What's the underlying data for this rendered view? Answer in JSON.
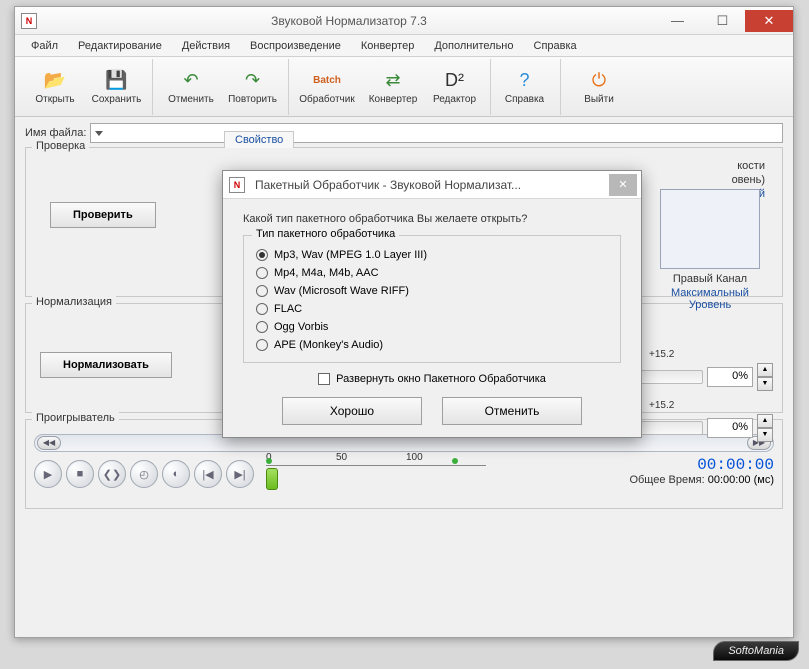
{
  "titlebar": {
    "title": "Звуковой Нормализатор 7.3",
    "icon_text": "N"
  },
  "menu": [
    "Файл",
    "Редактирование",
    "Действия",
    "Воспроизведение",
    "Конвертер",
    "Дополнительно",
    "Справка"
  ],
  "toolbar": [
    {
      "label": "Открыть",
      "icon": "📂",
      "color": "#e8a02c"
    },
    {
      "label": "Сохранить",
      "icon": "💾",
      "color": "#5a7fb8"
    },
    {
      "label": "Отменить",
      "icon": "↶",
      "color": "#3a8a3a"
    },
    {
      "label": "Повторить",
      "icon": "↷",
      "color": "#3a8a3a"
    },
    {
      "label": "Обработчик",
      "icon": "Batch",
      "color": "#d06020",
      "small": true
    },
    {
      "label": "Конвертер",
      "icon": "⇄",
      "color": "#3a8a3a"
    },
    {
      "label": "Редактор",
      "icon": "D²",
      "color": "#333"
    },
    {
      "label": "Справка",
      "icon": "?",
      "color": "#2a8cd8"
    },
    {
      "label": "Выйти",
      "icon": "⏻",
      "color": "#e87018"
    }
  ],
  "file": {
    "label": "Имя файла:"
  },
  "check": {
    "group": "Проверка",
    "button": "Проверить",
    "tab": "Свойство"
  },
  "partial_lines": [
    "кости",
    "овень)",
    "мый"
  ],
  "channel": {
    "label": "Правый Канал",
    "link": "Максимальный Уровень"
  },
  "norm": {
    "group": "Нормализация",
    "button": "Нормализовать",
    "slider1_val": "+15.2",
    "slider1_pct": "0%",
    "slider2_val": "+15.2",
    "slider2_pct": "0%"
  },
  "player": {
    "group": "Проигрыватель",
    "ticks": [
      "0",
      "50",
      "100"
    ],
    "time_label": "Общее Время:",
    "time_blue": "00:00:00",
    "time_ms": "00:00:00 (мс)"
  },
  "dialog": {
    "title": "Пакетный Обработчик - Звуковой Нормализат...",
    "question": "Какой тип пакетного обработчика Вы желаете открыть?",
    "group": "Тип пакетного обработчика",
    "options": [
      "Mp3, Wav (MPEG 1.0 Layer III)",
      "Mp4, M4a, M4b, AAC",
      "Wav (Microsoft Wave RIFF)",
      "FLAC",
      "Ogg Vorbis",
      "APE (Monkey's Audio)"
    ],
    "selected": 0,
    "expand": "Развернуть окно Пакетного Обработчика",
    "ok": "Хорошо",
    "cancel": "Отменить"
  },
  "watermark": "SoftoMania"
}
